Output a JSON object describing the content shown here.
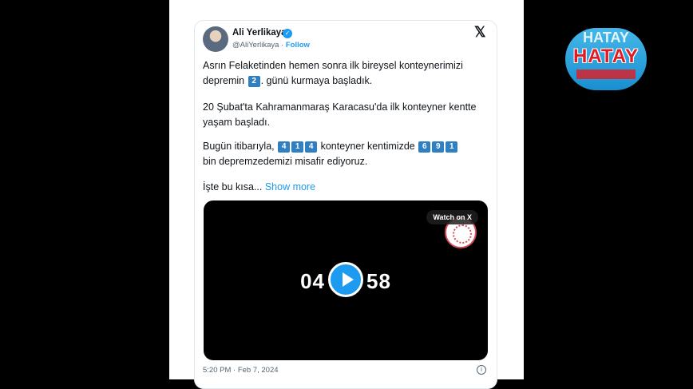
{
  "author": {
    "name": "Ali Yerlikaya",
    "handle": "@AliYerlikaya",
    "separator": " · ",
    "follow": "Follow"
  },
  "icons": {
    "verified": "verified-icon",
    "x": "x-logo-icon",
    "play": "play-icon",
    "info": "info-icon"
  },
  "tweet": {
    "p1_a": "Asrın Felaketinden hemen sonra ilk bireysel konteynerimizi",
    "p1_b": "depremin",
    "p1_num": "2",
    "p1_c": ". günü kurmaya başladık.",
    "p2": "20 Şubat'ta Kahramanmaraş Karacasu'da ilk konteyner kentte yaşam başladı.",
    "p3_a": "Bugün itibarıyla,",
    "n1": [
      "4",
      "1",
      "4"
    ],
    "p3_b": "konteyner kentimizde",
    "n2": [
      "6",
      "9",
      "1"
    ],
    "p3_c": "bin depremzedemizi misafir ediyoruz.",
    "p4": "İşte bu kısa...",
    "show_more": "Show more"
  },
  "video": {
    "watch_label": "Watch on X",
    "left_digits": "04",
    "right_digits": "58"
  },
  "timestamp": "5:20 PM · Feb 7, 2024",
  "watermark": {
    "top": "HATAY",
    "main": "HATAY"
  },
  "colors": {
    "accent": "#1d9bf0",
    "number_box": "#2f7fc3",
    "logo_red": "#e11b22"
  }
}
